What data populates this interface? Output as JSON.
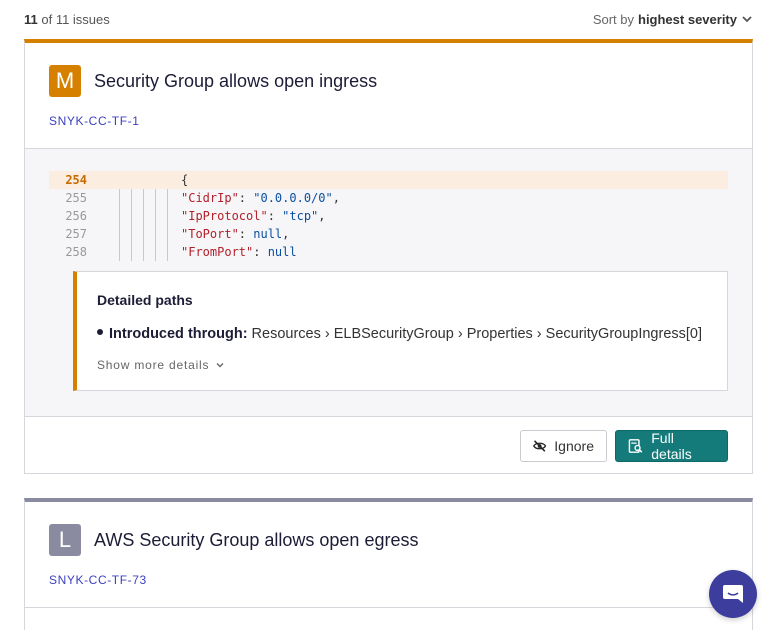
{
  "topbar": {
    "count_current": "11",
    "count_rest": " of 11 issues",
    "sort_label": "Sort by ",
    "sort_value": "highest severity"
  },
  "issues": [
    {
      "severity": "M",
      "severity_color": "#d68000",
      "title": "Security Group allows open ingress",
      "id": "SNYK-CC-TF-1",
      "code": [
        {
          "line": "254",
          "text": "{"
        },
        {
          "line": "255",
          "key": "\"CidrIp\"",
          "value": "\"0.0.0.0/0\"",
          "tail": ","
        },
        {
          "line": "256",
          "key": "\"IpProtocol\"",
          "value": "\"tcp\"",
          "tail": ","
        },
        {
          "line": "257",
          "key": "\"ToPort\"",
          "value": "null",
          "tail": ","
        },
        {
          "line": "258",
          "key": "\"FromPort\"",
          "value": "null",
          "tail": ""
        }
      ],
      "detailed_paths": {
        "heading": "Detailed paths",
        "introduced_label": "Introduced through:",
        "introduced_path": "Resources › ELBSecurityGroup › Properties › SecurityGroupIngress[0]",
        "show_more": "Show more details"
      },
      "actions": {
        "ignore": "Ignore",
        "full_details": "Full details"
      }
    },
    {
      "severity": "L",
      "severity_color": "#8a8ba0",
      "title": "AWS Security Group allows open egress",
      "id": "SNYK-CC-TF-73"
    }
  ],
  "colors": {
    "accent_teal": "#147a7a",
    "medium": "#d68000",
    "low": "#8a8ba0",
    "chat": "#3d3d9e"
  }
}
